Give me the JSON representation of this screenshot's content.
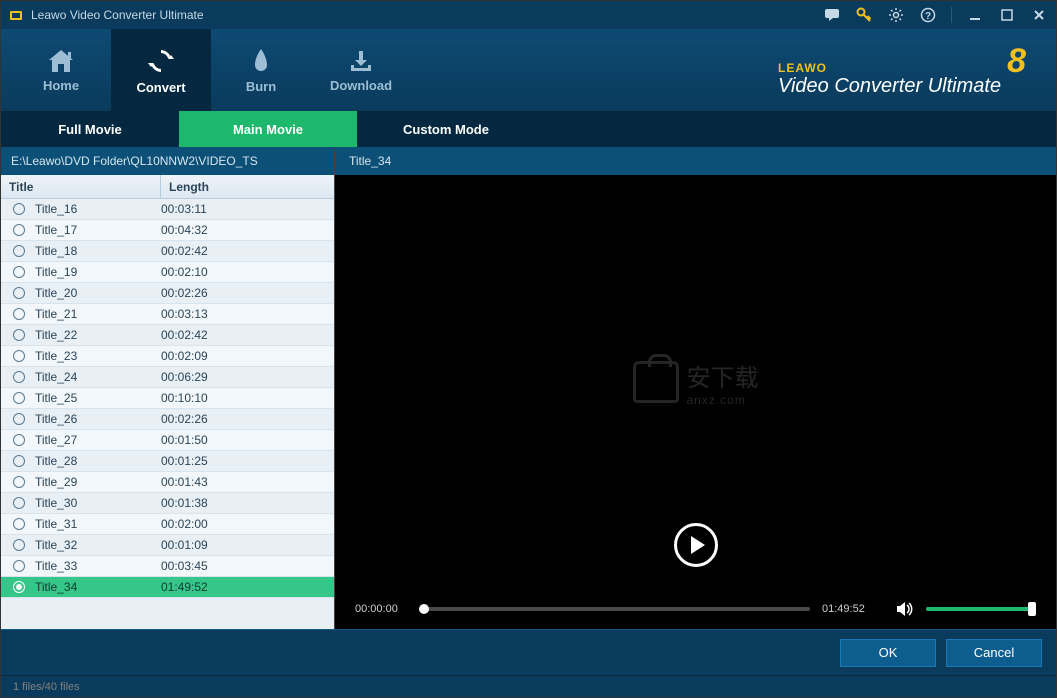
{
  "titlebar": {
    "title": "Leawo Video Converter Ultimate"
  },
  "nav": {
    "home": "Home",
    "convert": "Convert",
    "burn": "Burn",
    "download": "Download"
  },
  "brand": {
    "top": "LEAWO",
    "main": "Video Converter Ultimate",
    "version": "8"
  },
  "modes": {
    "full": "Full Movie",
    "main": "Main Movie",
    "custom": "Custom Mode"
  },
  "path": "E:\\Leawo\\DVD Folder\\QL10NNW2\\VIDEO_TS",
  "columns": {
    "title": "Title",
    "length": "Length"
  },
  "titles": [
    {
      "name": "Title_16",
      "length": "00:03:11",
      "selected": false
    },
    {
      "name": "Title_17",
      "length": "00:04:32",
      "selected": false
    },
    {
      "name": "Title_18",
      "length": "00:02:42",
      "selected": false
    },
    {
      "name": "Title_19",
      "length": "00:02:10",
      "selected": false
    },
    {
      "name": "Title_20",
      "length": "00:02:26",
      "selected": false
    },
    {
      "name": "Title_21",
      "length": "00:03:13",
      "selected": false
    },
    {
      "name": "Title_22",
      "length": "00:02:42",
      "selected": false
    },
    {
      "name": "Title_23",
      "length": "00:02:09",
      "selected": false
    },
    {
      "name": "Title_24",
      "length": "00:06:29",
      "selected": false
    },
    {
      "name": "Title_25",
      "length": "00:10:10",
      "selected": false
    },
    {
      "name": "Title_26",
      "length": "00:02:26",
      "selected": false
    },
    {
      "name": "Title_27",
      "length": "00:01:50",
      "selected": false
    },
    {
      "name": "Title_28",
      "length": "00:01:25",
      "selected": false
    },
    {
      "name": "Title_29",
      "length": "00:01:43",
      "selected": false
    },
    {
      "name": "Title_30",
      "length": "00:01:38",
      "selected": false
    },
    {
      "name": "Title_31",
      "length": "00:02:00",
      "selected": false
    },
    {
      "name": "Title_32",
      "length": "00:01:09",
      "selected": false
    },
    {
      "name": "Title_33",
      "length": "00:03:45",
      "selected": false
    },
    {
      "name": "Title_34",
      "length": "01:49:52",
      "selected": true
    }
  ],
  "preview": {
    "current_title": "Title_34",
    "time_start": "00:00:00",
    "time_end": "01:49:52",
    "watermark_cn": "安下载",
    "watermark_en": "anxz.com"
  },
  "buttons": {
    "ok": "OK",
    "cancel": "Cancel"
  },
  "status": "1 files/40 files"
}
